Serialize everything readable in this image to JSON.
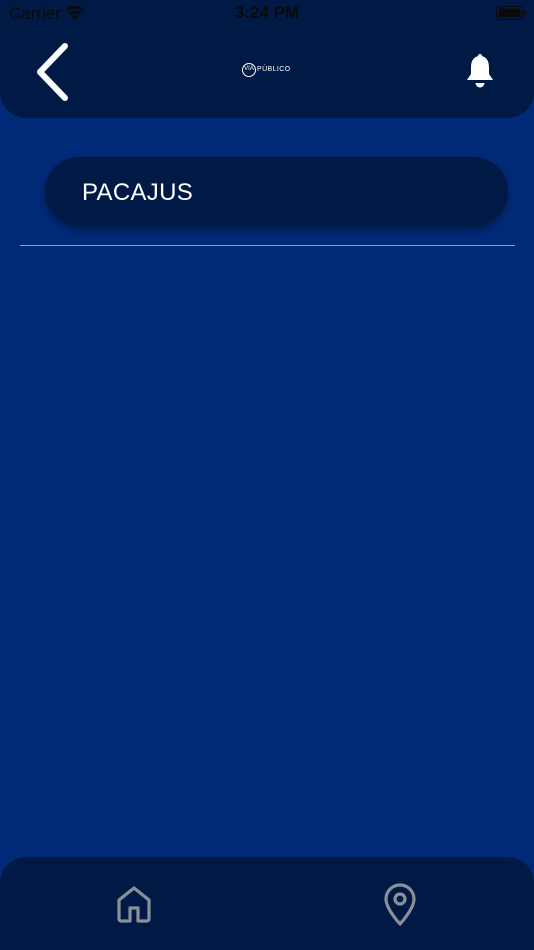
{
  "status_bar": {
    "carrier": "Carrier",
    "time": "3:24 PM",
    "wifi_icon": "wifi-icon",
    "battery_icon": "battery-full-icon"
  },
  "header": {
    "back_icon": "chevron-left-icon",
    "logo_text_via": "VIA",
    "logo_text_rest": "PÚBLICO",
    "notification_icon": "bell-icon"
  },
  "city_selector": {
    "label": "PACAJUS"
  },
  "bottom_nav": {
    "items": [
      {
        "icon": "home-icon"
      },
      {
        "icon": "location-pin-icon"
      }
    ]
  },
  "colors": {
    "background": "#002a78",
    "bar": "#001a45",
    "text": "#ffffff",
    "nav_icon": "#8a8f99"
  }
}
